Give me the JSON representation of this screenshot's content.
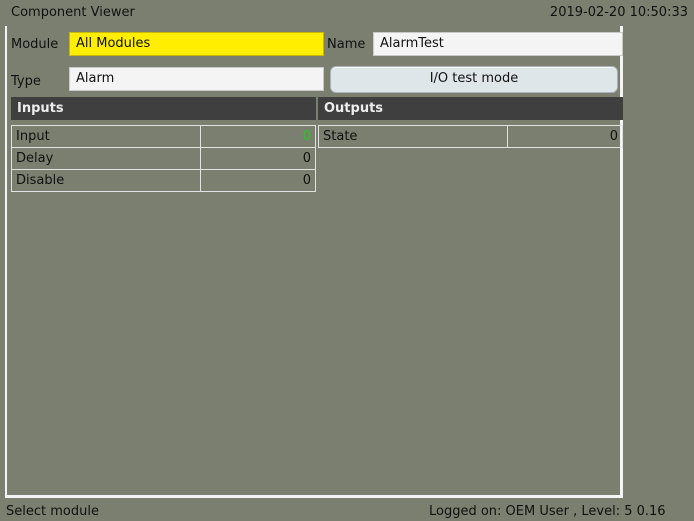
{
  "app": {
    "title": "Component Viewer",
    "datetime": "2019-02-20  10:50:33"
  },
  "form": {
    "module_label": "Module",
    "module_value": "All Modules",
    "name_label": "Name",
    "name_value": "AlarmTest",
    "type_label": "Type",
    "type_value": "Alarm",
    "io_button": "I/O test mode"
  },
  "inputs": {
    "header": "Inputs",
    "rows": [
      {
        "name": "Input",
        "value": "0"
      },
      {
        "name": "Delay",
        "value": "0"
      },
      {
        "name": "Disable",
        "value": "0"
      }
    ]
  },
  "outputs": {
    "header": "Outputs",
    "rows": [
      {
        "name": "State",
        "value": "0"
      }
    ]
  },
  "status": {
    "message": "Select module",
    "login": "Logged on: OEM User , Level: 5   0.16"
  },
  "colors": {
    "background": "#7b7f70",
    "module_highlight": "#ffee00",
    "active_value": "#1fcc1f"
  }
}
